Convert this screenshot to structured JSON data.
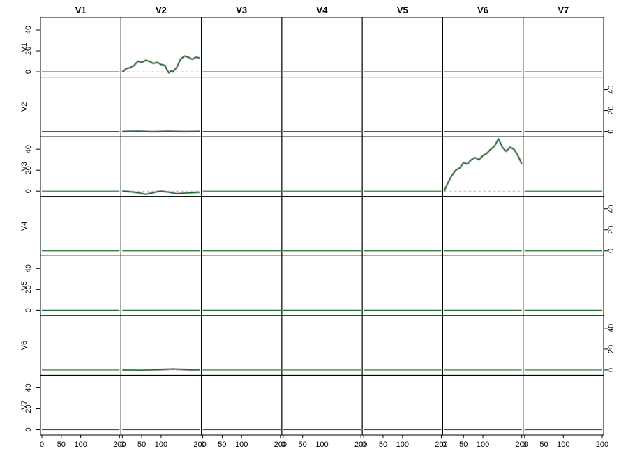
{
  "chart_data": {
    "type": "line",
    "grid_of_panels": "7x7 matrix of line plots (row variable response to column variable shock)",
    "row_labels": [
      "V1",
      "V2",
      "V3",
      "V4",
      "V5",
      "V6",
      "V7"
    ],
    "column_labels": [
      "V1",
      "V2",
      "V3",
      "V4",
      "V5",
      "V6",
      "V7"
    ],
    "ylim": [
      -5,
      52
    ],
    "xlim": [
      0,
      200
    ],
    "y_ticks": [
      0,
      20,
      40
    ],
    "x_ticks": [
      0,
      50,
      100,
      200
    ],
    "y_axis_side": [
      "left",
      "right",
      "left",
      "right",
      "left",
      "right",
      "left"
    ],
    "band_color": "#888888",
    "line_color": "#1f6f2a",
    "zero_line_color": "#bbbbbb",
    "panels": {
      "V1_V2": {
        "x": [
          0,
          10,
          20,
          30,
          40,
          50,
          60,
          70,
          80,
          90,
          100,
          110,
          115,
          120,
          125,
          130,
          140,
          150,
          160,
          170,
          180,
          190,
          200
        ],
        "y": [
          0,
          3,
          4,
          6,
          10,
          9,
          11,
          10,
          8,
          9,
          7,
          6,
          2,
          -1,
          1,
          0,
          4,
          12,
          15,
          14,
          12,
          14,
          13
        ]
      },
      "V2_V2": {
        "x": [
          0,
          40,
          80,
          120,
          160,
          200
        ],
        "y": [
          0,
          0.3,
          -0.2,
          0.2,
          -0.1,
          0.1
        ]
      },
      "V3_V2": {
        "x": [
          0,
          20,
          40,
          60,
          80,
          90,
          100,
          120,
          140,
          160,
          180,
          200
        ],
        "y": [
          0,
          -0.5,
          -1.5,
          -3,
          -1.5,
          -0.5,
          0,
          -1,
          -2.5,
          -2,
          -1.5,
          -1
        ]
      },
      "V3_V6": {
        "x": [
          0,
          10,
          20,
          30,
          40,
          50,
          60,
          70,
          80,
          90,
          100,
          110,
          120,
          130,
          140,
          150,
          160,
          170,
          180,
          190,
          200
        ],
        "y": [
          0,
          8,
          15,
          20,
          22,
          27,
          26,
          30,
          32,
          30,
          34,
          36,
          40,
          43,
          50,
          42,
          38,
          42,
          40,
          34,
          26
        ]
      },
      "V6_V2": {
        "x": [
          0,
          50,
          100,
          130,
          150,
          180,
          200
        ],
        "y": [
          0,
          -0.2,
          0.4,
          1,
          0.6,
          0,
          0.3
        ]
      }
    }
  }
}
